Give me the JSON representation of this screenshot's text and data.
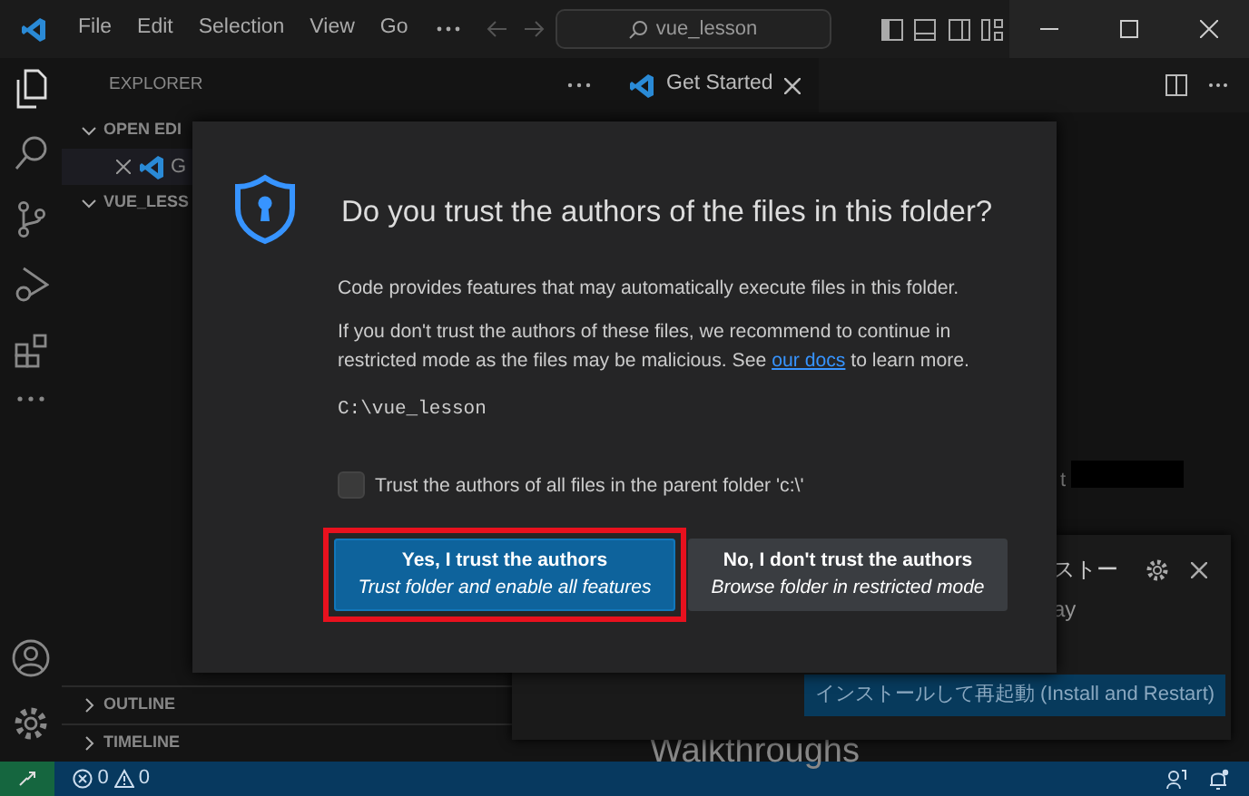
{
  "title_bar": {
    "menu": [
      "File",
      "Edit",
      "Selection",
      "View",
      "Go"
    ],
    "search": "vue_lesson"
  },
  "sidebar": {
    "title": "EXPLORER",
    "sections": [
      {
        "label": "OPEN EDI",
        "expanded": true,
        "items": [
          {
            "label": "G"
          }
        ]
      },
      {
        "label": "VUE_LESS",
        "expanded": true
      },
      {
        "label": "OUTLINE",
        "expanded": false
      },
      {
        "label": "TIMELINE",
        "expanded": false
      }
    ]
  },
  "editor": {
    "tabs": [
      {
        "label": "Get Started",
        "selected": true
      }
    ],
    "partial_text": "t",
    "heading": "Walkthroughs"
  },
  "notification": {
    "title": "ストー",
    "message": "ay",
    "button": "インストールして再起動 (Install and Restart)"
  },
  "dialog": {
    "title": "Do you trust the authors of the files in this folder?",
    "paragraph": "Code provides features that may automatically execute files in this folder.",
    "warning": {
      "before": "If you don't trust the authors of these files, we recommend to continue in restricted mode as the files may be malicious. See ",
      "link": "our docs",
      "after": " to learn more."
    },
    "path": "C:\\vue_lesson",
    "checkbox": {
      "label": "Trust the authors of all files in the parent folder 'c:\\'",
      "checked": false
    },
    "buttons": [
      {
        "label": "Yes, I trust the authors",
        "sublabel": "Trust folder and enable all features",
        "kind": "primary",
        "highlighted": true
      },
      {
        "label": "No, I don't trust the authors",
        "sublabel": "Browse folder in restricted mode",
        "kind": "secondary",
        "highlighted": false
      }
    ]
  },
  "status_bar": {
    "errors": "0",
    "warnings": "0"
  }
}
